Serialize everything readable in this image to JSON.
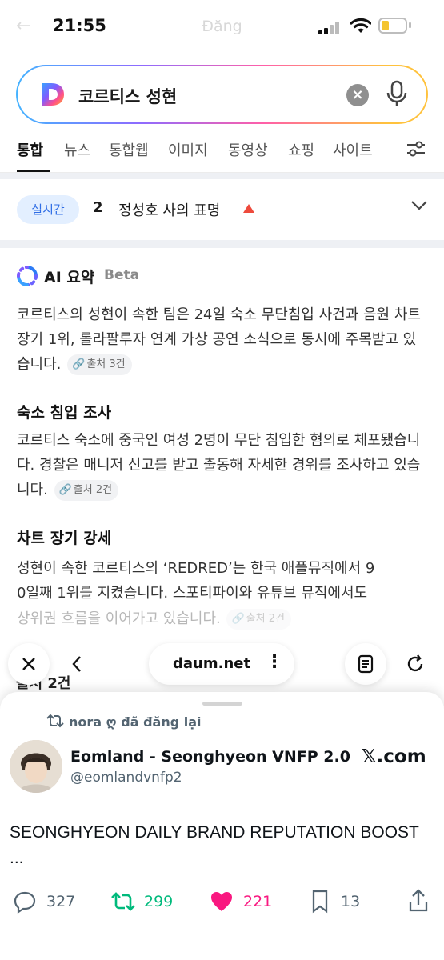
{
  "status": {
    "time": "21:55",
    "ghost_title": "Đăng"
  },
  "search": {
    "query": "코르티스 성현"
  },
  "tabs": [
    {
      "label": "통합",
      "active": true
    },
    {
      "label": "뉴스"
    },
    {
      "label": "통합웹"
    },
    {
      "label": "이미지"
    },
    {
      "label": "동영상"
    },
    {
      "label": "쇼핑"
    },
    {
      "label": "사이트"
    }
  ],
  "realtime": {
    "badge": "실시간",
    "rank": "2",
    "text": "정성호 사의 표명"
  },
  "ai_summary": {
    "title": "AI 요약",
    "beta": "Beta",
    "intro": "코르티스의 성현이 속한 팀은 24일 숙소 무단침입 사건과 음원 차트 장기 1위, 롤라팔루자 연계 가상 공연 소식으로 동시에 주목받고 있습니다.",
    "intro_cite": "출처 3건",
    "sections": [
      {
        "title": "숙소 침입 조사",
        "body": "코르티스 숙소에 중국인 여성 2명이 무단 침입한 혐의로 체포됐습니다. 경찰은 매니저 신고를 받고 출동해 자세한 경위를 조사하고 있습니다.",
        "cite": "출처 2건"
      },
      {
        "title": "차트 장기 강세",
        "body_line1": "성현이 속한 코르티스의 ‘REDRED’는 한국 애플뮤직에서 9",
        "body_line2": "0일째 1위를 지켰습니다. 스포티파이와 유튜브 뮤직에서도",
        "body_line3": "상위권 흐름을 이어가고 있습니다.",
        "cite": "출처 2건"
      }
    ],
    "peek_text": "출처 2건"
  },
  "browser": {
    "url": "daum.net"
  },
  "tweet": {
    "repost_label": "nora ღ đã đăng lại",
    "author_name": "Eomland - Seonghyeon VNFP 2.0",
    "author_handle": "@eomlandvnfp2",
    "source": "𝕏.com",
    "text": "SEONGHYEON DAILY BRAND REPUTATION BOOST ...",
    "replies": "327",
    "reposts": "299",
    "likes": "221",
    "bookmarks": "13"
  },
  "colors": {
    "accent_blue": "#2f6de5",
    "repost_green": "#00ba7c",
    "like_pink": "#f91880",
    "trend_up": "#ee4a3c"
  }
}
